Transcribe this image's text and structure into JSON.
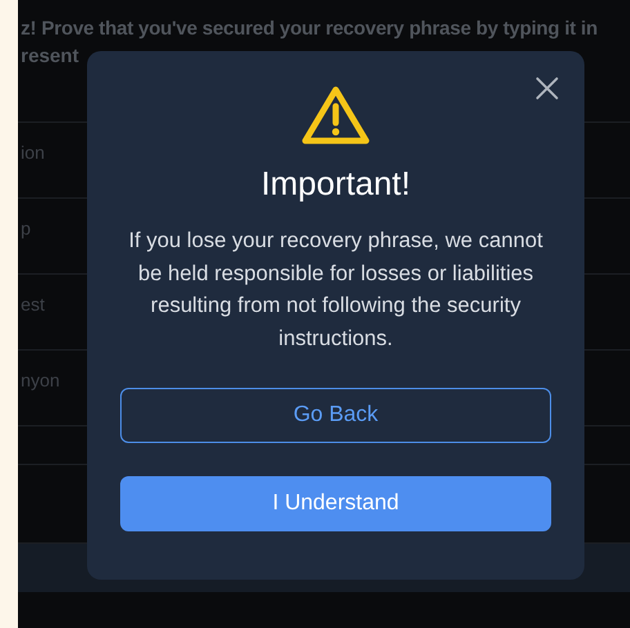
{
  "background": {
    "heading": "z! Prove that you've secured your recovery phrase by typing it in",
    "heading_2": "resent",
    "rows": [
      {
        "label": "ion"
      },
      {
        "label": "p"
      },
      {
        "label": "est"
      },
      {
        "label": "nyon"
      }
    ]
  },
  "dialog": {
    "title": "Important!",
    "message": "If you lose your recovery phrase, we cannot be held responsible for losses or liabilities resulting from not following the security instructions.",
    "buttons": [
      {
        "label": "Go Back",
        "kind": "outline"
      },
      {
        "label": "I Understand",
        "kind": "primary"
      }
    ]
  }
}
